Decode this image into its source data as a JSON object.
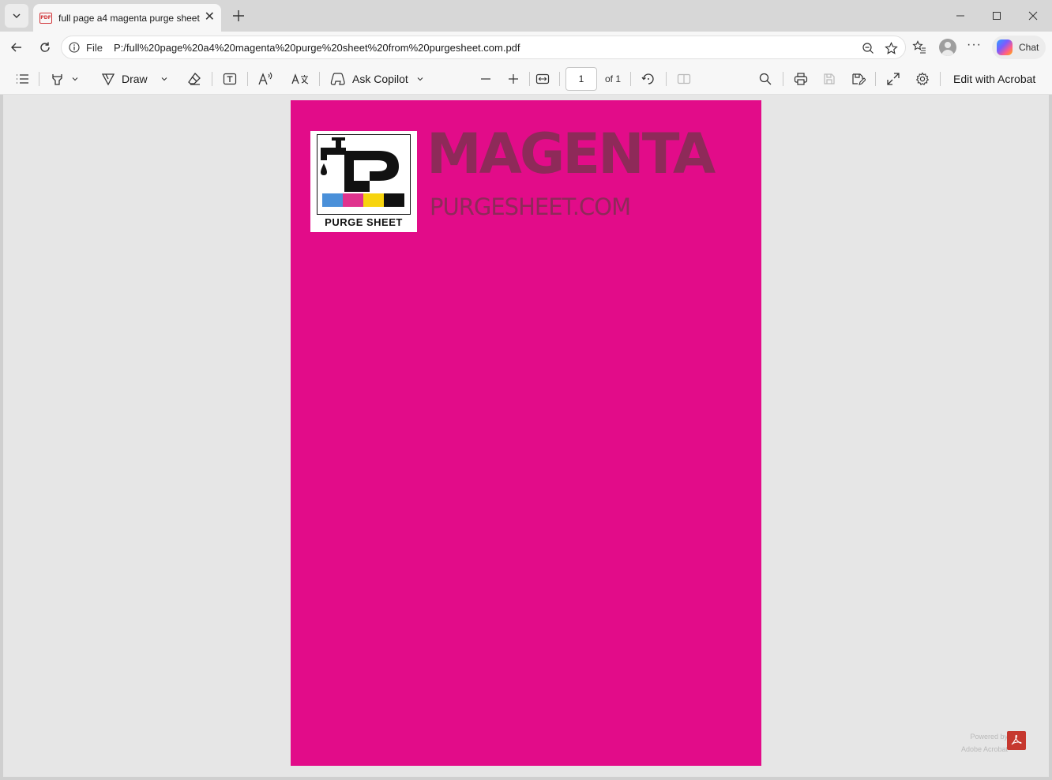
{
  "window": {
    "tab_title": "full page a4 magenta purge sheet",
    "tab_icon": "pdf-file-icon",
    "badge_text": "PDF"
  },
  "address_bar": {
    "scheme_label": "File",
    "url": "P:/full%20page%20a4%20magenta%20purge%20sheet%20from%20purgesheet.com.pdf"
  },
  "chat_label": "Chat",
  "pdf_toolbar": {
    "draw_label": "Draw",
    "ask_copilot_label": "Ask Copilot",
    "page_current": "1",
    "page_total_label": "of 1",
    "edit_label": "Edit with Acrobat"
  },
  "document": {
    "background_color": "#e20c89",
    "title": "MAGENTA",
    "subtitle": "PURGESHEET.COM",
    "logo_text": "PURGE SHEET",
    "logo_swatches": [
      "#4a90d9",
      "#e0338e",
      "#f7d40e",
      "#111111"
    ],
    "title_color": "#8e2a59"
  },
  "viewer_footer": {
    "powered_line1": "Powered by",
    "powered_line2": "Adobe Acrobat"
  }
}
